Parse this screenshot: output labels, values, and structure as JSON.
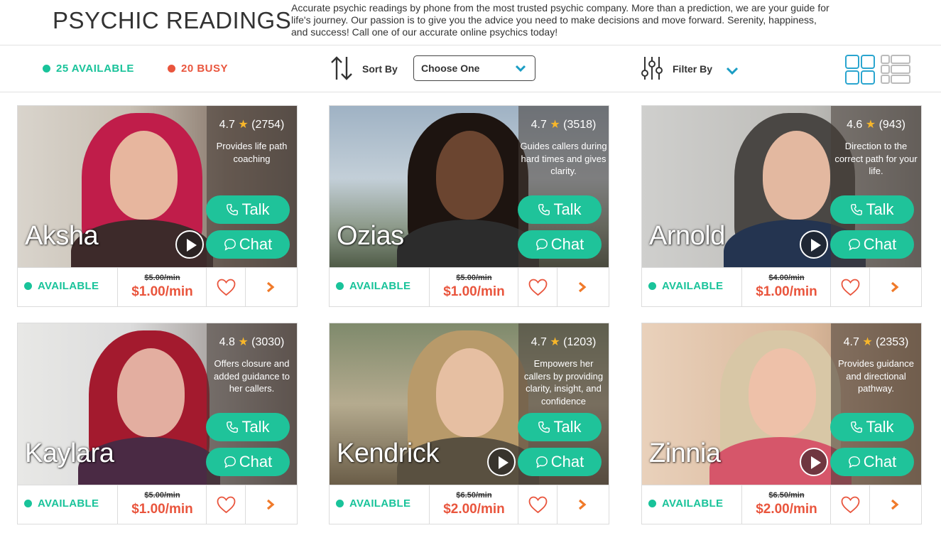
{
  "header": {
    "title": "PSYCHIC READINGS",
    "intro": "Accurate psychic readings by phone from the most trusted psychic company. More than a prediction, we are your guide for life's journey. Our passion is to give you the advice you need to make decisions and move forward. Serenity, happiness, and success! Call one of our accurate online psychics today!"
  },
  "toolbar": {
    "available_label": "25 AVAILABLE",
    "busy_label": "20 BUSY",
    "sort_label": "Sort By",
    "sort_value": "Choose One",
    "filter_label": "Filter By"
  },
  "colors": {
    "accent": "#1fc39a",
    "busy": "#e9553d",
    "price": "#e9553d"
  },
  "cards": [
    {
      "name": "Aksha",
      "rating": "4.7",
      "reviews": "(2754)",
      "description": "Provides life path coaching",
      "talk": "Talk",
      "chat": "Chat",
      "status": "AVAILABLE",
      "old_price": "$5.00/min",
      "price": "$1.00/min"
    },
    {
      "name": "Ozias",
      "rating": "4.7",
      "reviews": "(3518)",
      "description": "Guides callers during hard times and gives clarity.",
      "talk": "Talk",
      "chat": "Chat",
      "status": "AVAILABLE",
      "old_price": "$5.00/min",
      "price": "$1.00/min"
    },
    {
      "name": "Arnold",
      "rating": "4.6",
      "reviews": "(943)",
      "description": "Direction to the correct path for your life.",
      "talk": "Talk",
      "chat": "Chat",
      "status": "AVAILABLE",
      "old_price": "$4.00/min",
      "price": "$1.00/min"
    },
    {
      "name": "Kaylara",
      "rating": "4.8",
      "reviews": "(3030)",
      "description": "Offers closure and added guidance to her callers.",
      "talk": "Talk",
      "chat": "Chat",
      "status": "AVAILABLE",
      "old_price": "$5.00/min",
      "price": "$1.00/min"
    },
    {
      "name": "Kendrick",
      "rating": "4.7",
      "reviews": "(1203)",
      "description": "Empowers her callers by providing clarity, insight, and confidence",
      "talk": "Talk",
      "chat": "Chat",
      "status": "AVAILABLE",
      "old_price": "$6.50/min",
      "price": "$2.00/min"
    },
    {
      "name": "Zinnia",
      "rating": "4.7",
      "reviews": "(2353)",
      "description": "Provides guidance and directional pathway.",
      "talk": "Talk",
      "chat": "Chat",
      "status": "AVAILABLE",
      "old_price": "$6.50/min",
      "price": "$2.00/min"
    }
  ]
}
